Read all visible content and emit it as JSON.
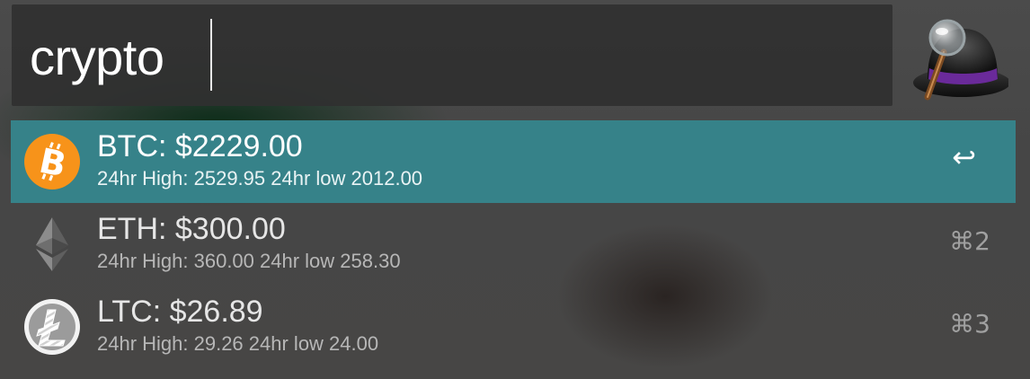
{
  "search": {
    "query": "crypto"
  },
  "colors": {
    "selection": "#368289",
    "btc_orange": "#F7931A"
  },
  "results": [
    {
      "title": "BTC: $2229.00",
      "subtitle": "24hr High: 2529.95 24hr low 2012.00",
      "shortcut": "↩",
      "icon": "bitcoin-icon",
      "selected": true
    },
    {
      "title": "ETH: $300.00",
      "subtitle": "24hr High: 360.00 24hr low 258.30",
      "shortcut": "⌘2",
      "icon": "ethereum-icon",
      "selected": false
    },
    {
      "title": "LTC: $26.89",
      "subtitle": "24hr High: 29.26 24hr low 24.00",
      "shortcut": "⌘3",
      "icon": "litecoin-icon",
      "selected": false
    }
  ]
}
